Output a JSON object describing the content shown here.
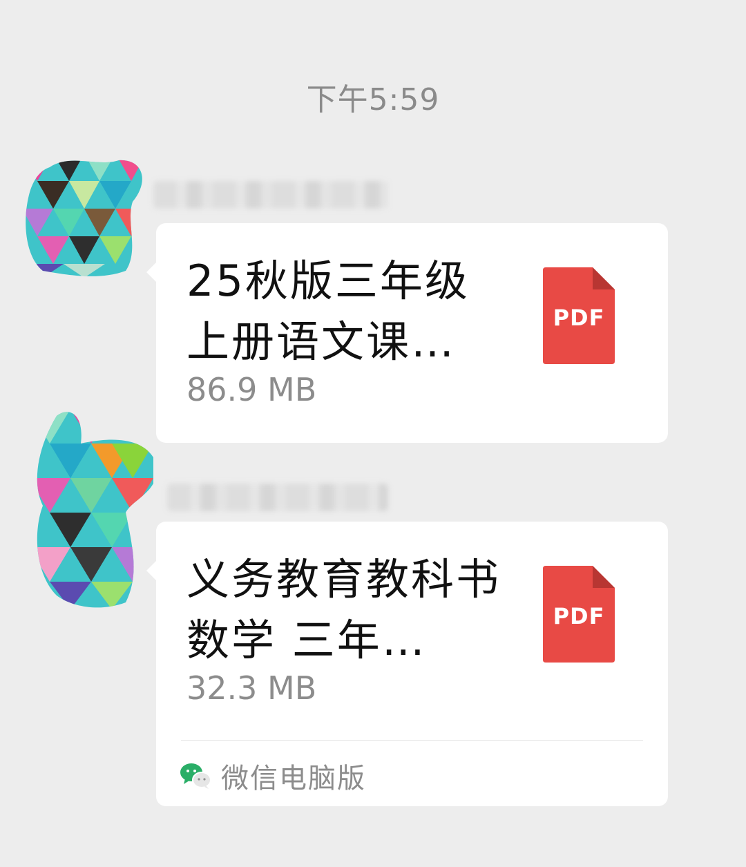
{
  "chat": {
    "timestamp": "下午5:59",
    "messages": [
      {
        "file_name": "25秋版三年级上册语文课…",
        "file_size": "86.9 MB",
        "file_type": "PDF"
      },
      {
        "file_name": "义务教育教科书 数学 三年…",
        "file_size": "32.3 MB",
        "file_type": "PDF",
        "source": "微信电脑版"
      }
    ]
  },
  "colors": {
    "background": "#ededed",
    "bubble": "#ffffff",
    "pdf_red": "#e84a45",
    "pdf_fold": "#b83632",
    "wechat_green": "#2aae67"
  },
  "icons": {
    "avatar": "mosaic-avatar",
    "file": "pdf-file-icon",
    "source": "wechat-icon"
  }
}
